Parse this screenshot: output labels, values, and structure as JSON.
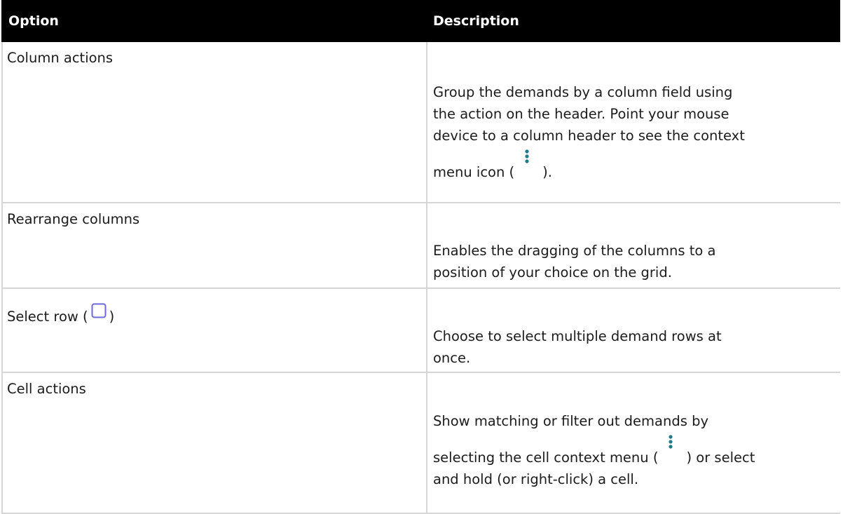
{
  "header": {
    "option": "Option",
    "description": "Description"
  },
  "rows": [
    {
      "option": "Column actions",
      "desc_lines": [
        "Group the demands by a column field using",
        "the action on the header. Point your mouse",
        "device to a column header to see the context"
      ],
      "desc_pre_icon": "menu icon (",
      "desc_post_icon": ")."
    },
    {
      "option": "Rearrange columns",
      "desc_lines": [
        "Enables the dragging of the columns to a",
        "position of your choice on the grid."
      ]
    },
    {
      "option_pre_icon": "Select row (",
      "option_post_icon": ")",
      "desc_lines": [
        "Choose to select multiple demand rows at",
        "once."
      ]
    },
    {
      "option": "Cell actions",
      "desc_lines": [
        "Show matching or filter out demands by"
      ],
      "desc_pre_icon": "selecting the cell context menu (",
      "desc_post_icon": ") or select",
      "desc_after_lines": [
        "and hold (or right-click) a cell."
      ]
    }
  ],
  "colors": {
    "header_bg": "#000000",
    "header_text": "#ffffff",
    "border": "#d6d6d6",
    "icon_teal": "#1f7a8c",
    "checkbox_stroke": "#6b6bd6"
  },
  "icons": {
    "menu": "kebab-menu-icon",
    "checkbox": "checkbox-icon"
  }
}
